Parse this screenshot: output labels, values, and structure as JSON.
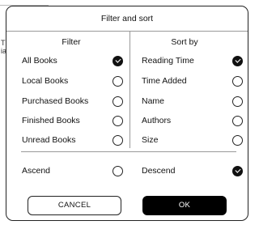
{
  "dialog": {
    "title": "Filter and sort"
  },
  "filter": {
    "header": "Filter",
    "items": [
      {
        "label": "All Books",
        "checked": true
      },
      {
        "label": "Local Books",
        "checked": false
      },
      {
        "label": "Purchased Books",
        "checked": false
      },
      {
        "label": "Finished Books",
        "checked": false
      },
      {
        "label": "Unread Books",
        "checked": false
      }
    ]
  },
  "sort": {
    "header": "Sort by",
    "items": [
      {
        "label": "Reading Time",
        "checked": true
      },
      {
        "label": "Time Added",
        "checked": false
      },
      {
        "label": "Name",
        "checked": false
      },
      {
        "label": "Authors",
        "checked": false
      },
      {
        "label": "Size",
        "checked": false
      }
    ]
  },
  "order": {
    "ascend_label": "Ascend",
    "ascend_checked": false,
    "descend_label": "Descend",
    "descend_checked": true
  },
  "buttons": {
    "cancel_label": "CANCEL",
    "ok_label": "OK"
  },
  "background": {
    "left_fragment": "T\nia"
  },
  "colors": {
    "accent": "#000000",
    "border": "#222222",
    "divider": "#999999"
  }
}
